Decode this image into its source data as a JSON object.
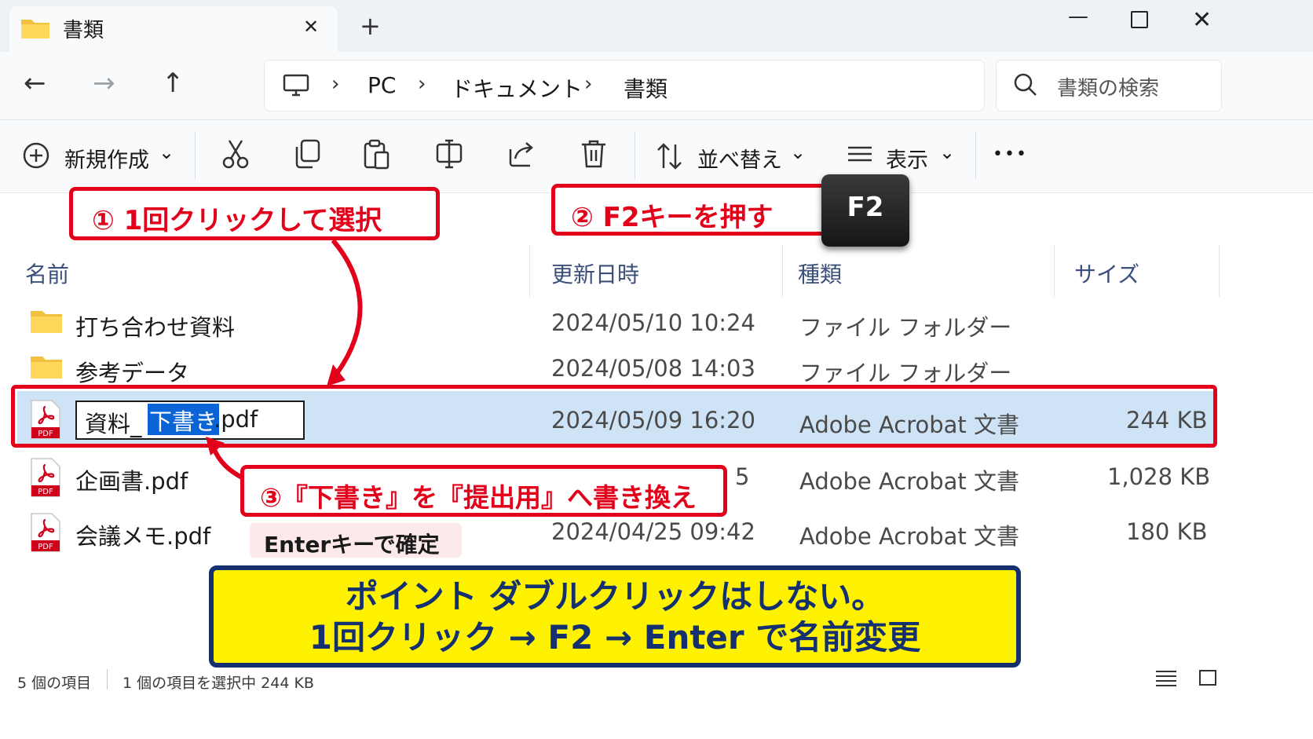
{
  "window": {
    "tab_title": "書類",
    "tab_close": "✕",
    "new_tab": "+",
    "minimize": "—",
    "close": "✕"
  },
  "nav": {
    "back": "←",
    "forward": "→",
    "up": "↑",
    "breadcrumbs": [
      "PC",
      "ドキュメント",
      "書類"
    ],
    "separator": "›",
    "search_placeholder": "書類の検索"
  },
  "toolbar": {
    "new_label": "新規作成",
    "sort_label": "並べ替え",
    "view_label": "表示",
    "more": "•••",
    "dropdown": "⌄"
  },
  "columns": {
    "name": "名前",
    "modified": "更新日時",
    "type": "種類",
    "size": "サイズ"
  },
  "files": [
    {
      "icon": "folder-icon",
      "name": "打ち合わせ資料",
      "date": "2024/05/10 10:24",
      "type": "ファイル フォルダー",
      "size": ""
    },
    {
      "icon": "folder-icon",
      "name": "参考データ",
      "date": "2024/05/08 14:03",
      "type": "ファイル フォルダー",
      "size": ""
    },
    {
      "icon": "pdf-icon",
      "name": "資料_下書き.pdf",
      "date": "2024/05/09 16:20",
      "type": "Adobe Acrobat 文書",
      "size": "244 KB",
      "selected": true
    },
    {
      "icon": "pdf-icon",
      "name": "企画書.pdf",
      "date": "5",
      "type": "Adobe Acrobat 文書",
      "size": "1,028 KB"
    },
    {
      "icon": "pdf-icon",
      "name": "会議メモ.pdf",
      "date": "2024/04/25 09:42",
      "type": "Adobe Acrobat 文書",
      "size": "180 KB"
    }
  ],
  "rename": {
    "prefix": "資料_",
    "selected_part": "下書き",
    "suffix": ".pdf"
  },
  "pdf_badge": "PDF",
  "callouts": {
    "step1": "① 1回クリックして選択",
    "step2": "② F2キーを押す",
    "f2_key": "F2",
    "step3": "③『下書き』を『提出用』へ書き換え",
    "enter_note": "Enterキーで確定"
  },
  "point": {
    "line1": "ポイント ダブルクリックはしない。",
    "line2": "1回クリック → F2 → Enter で名前変更"
  },
  "status": {
    "count": "5 個の項目",
    "selection": "1 個の項目を選択中 244 KB"
  },
  "colors": {
    "accent_red": "#e2001a",
    "selection_blue": "#cfe3f7",
    "point_yellow": "#fff200",
    "point_navy": "#14306e"
  }
}
